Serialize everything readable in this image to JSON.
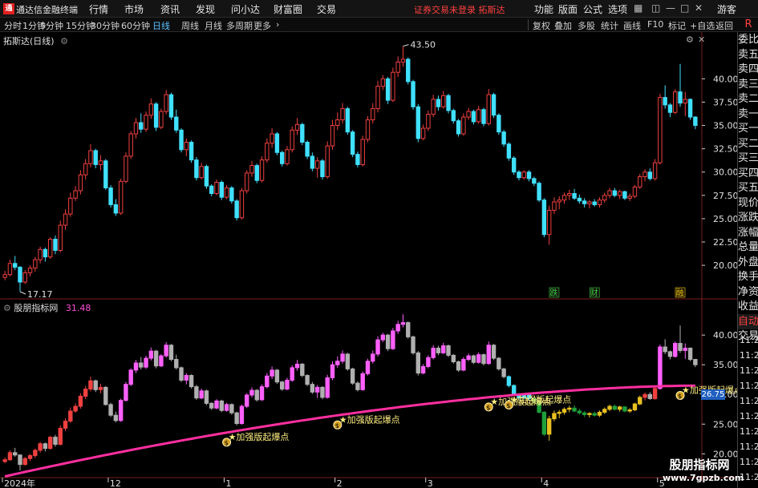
{
  "window": {
    "app_title": "通达信金融终端",
    "menu": [
      "行情",
      "市场",
      "资讯",
      "发现",
      "问小达",
      "财富圈",
      "交易"
    ],
    "warning": "证券交易未登录  拓斯达",
    "right_menu": [
      "功能",
      "版面",
      "公式",
      "选项"
    ],
    "window_controls": [
      "游客"
    ]
  },
  "toolbar": {
    "periods": [
      "分时",
      "1分钟",
      "5分钟",
      "15分钟",
      "30分钟",
      "60分钟",
      "日线",
      "周线",
      "月线",
      "多周期",
      "更多"
    ],
    "active_period": "日线",
    "tools": [
      "复权",
      "叠加",
      "多股",
      "统计",
      "画线",
      "F10",
      "标记",
      "+自选",
      "返回"
    ]
  },
  "main_panel": {
    "label": "拓斯达(日线)"
  },
  "sub_panel": {
    "label": "股朋指标网",
    "value": "31.48"
  },
  "side_panel": {
    "items": [
      "R",
      "委比",
      "卖五",
      "卖四",
      "卖三",
      "卖二",
      "卖一",
      "买一",
      "买二",
      "买三",
      "买四",
      "买五",
      "现价",
      "涨跌",
      "涨幅",
      "总量",
      "外盘",
      "换手",
      "净资",
      "收益",
      "自动",
      "交易"
    ],
    "times": [
      "11:29",
      "11:29",
      "11:29",
      "11:29",
      "11:29",
      "11:29",
      "11:29",
      "11:29",
      "11:29",
      "11:29"
    ]
  },
  "price_tag": "26.75",
  "watermark": {
    "line1": "股朋指标网",
    "line2": "www.7gpzb.com"
  },
  "chart_data": [
    {
      "type": "candlestick",
      "panel": "main",
      "y_ticks": [
        20.0,
        22.5,
        25.0,
        27.5,
        30.0,
        32.5,
        35.0,
        37.5,
        40.0
      ],
      "ylim": [
        17.0,
        44.5
      ],
      "x_ticks": [
        {
          "label": "2024年",
          "index": 0
        },
        {
          "label": "12",
          "index": 21
        },
        {
          "label": "1",
          "index": 44
        },
        {
          "label": "2",
          "index": 66
        },
        {
          "label": "3",
          "index": 84
        },
        {
          "label": "4",
          "index": 107
        },
        {
          "label": "5",
          "index": 130
        }
      ],
      "annotations": [
        {
          "text": "43.50",
          "index": 79,
          "price": 43.5
        },
        {
          "text": "17.17",
          "index": 3,
          "price": 17.17
        }
      ],
      "event_markers": [
        {
          "text": "跌",
          "index": 109,
          "color": "#3dcc3d"
        },
        {
          "text": "财",
          "index": 117,
          "color": "#3dcc3d"
        },
        {
          "text": "融",
          "index": 134,
          "color": "#ffcc00"
        }
      ],
      "ohlc": [
        [
          18.7,
          19.4,
          18.4,
          19.0
        ],
        [
          19.0,
          20.6,
          18.8,
          20.2
        ],
        [
          20.2,
          21.0,
          19.5,
          19.8
        ],
        [
          19.8,
          19.9,
          17.2,
          18.2
        ],
        [
          18.2,
          19.5,
          18.0,
          19.2
        ],
        [
          19.2,
          20.0,
          18.8,
          19.7
        ],
        [
          19.7,
          20.9,
          19.3,
          20.6
        ],
        [
          20.6,
          22.0,
          20.2,
          21.7
        ],
        [
          21.7,
          21.9,
          20.4,
          20.9
        ],
        [
          20.9,
          23.0,
          20.7,
          22.8
        ],
        [
          22.8,
          23.2,
          21.2,
          21.6
        ],
        [
          21.6,
          24.8,
          21.4,
          24.3
        ],
        [
          24.3,
          26.0,
          23.8,
          25.5
        ],
        [
          25.5,
          27.8,
          25.2,
          27.2
        ],
        [
          27.2,
          28.5,
          26.9,
          28.0
        ],
        [
          28.0,
          30.2,
          27.6,
          29.7
        ],
        [
          29.7,
          31.4,
          29.2,
          30.9
        ],
        [
          30.9,
          33.0,
          30.5,
          32.3
        ],
        [
          32.3,
          32.5,
          30.4,
          30.8
        ],
        [
          30.8,
          31.8,
          30.2,
          31.2
        ],
        [
          31.2,
          31.4,
          28.1,
          28.3
        ],
        [
          28.3,
          28.6,
          26.2,
          26.5
        ],
        [
          26.5,
          27.1,
          25.3,
          25.6
        ],
        [
          25.6,
          29.3,
          25.4,
          29.0
        ],
        [
          29.0,
          32.1,
          28.8,
          31.7
        ],
        [
          31.7,
          34.4,
          31.4,
          34.1
        ],
        [
          34.1,
          35.8,
          33.6,
          35.3
        ],
        [
          35.3,
          36.3,
          34.2,
          34.6
        ],
        [
          34.6,
          36.5,
          34.3,
          36.1
        ],
        [
          36.1,
          37.9,
          35.7,
          37.3
        ],
        [
          37.3,
          37.5,
          34.4,
          34.8
        ],
        [
          34.8,
          36.8,
          34.6,
          36.5
        ],
        [
          36.5,
          38.8,
          36.2,
          38.3
        ],
        [
          38.3,
          38.5,
          35.6,
          35.9
        ],
        [
          35.9,
          36.7,
          34.2,
          34.5
        ],
        [
          34.5,
          34.7,
          32.1,
          32.4
        ],
        [
          32.4,
          33.6,
          31.7,
          33.2
        ],
        [
          33.2,
          33.4,
          31.0,
          31.3
        ],
        [
          31.3,
          31.6,
          29.1,
          29.4
        ],
        [
          29.4,
          31.0,
          29.2,
          30.6
        ],
        [
          30.6,
          30.8,
          28.2,
          28.5
        ],
        [
          28.5,
          28.7,
          27.4,
          27.7
        ],
        [
          27.7,
          29.2,
          27.5,
          28.9
        ],
        [
          28.9,
          29.1,
          27.0,
          27.3
        ],
        [
          27.3,
          28.6,
          27.1,
          28.3
        ],
        [
          28.3,
          28.5,
          26.6,
          26.9
        ],
        [
          26.9,
          27.1,
          24.8,
          25.1
        ],
        [
          25.1,
          28.3,
          24.9,
          28.0
        ],
        [
          28.0,
          30.2,
          27.7,
          29.9
        ],
        [
          29.9,
          31.2,
          29.5,
          30.7
        ],
        [
          30.7,
          30.9,
          28.8,
          29.1
        ],
        [
          29.1,
          31.7,
          28.9,
          31.3
        ],
        [
          31.3,
          33.6,
          31.0,
          33.1
        ],
        [
          33.1,
          34.7,
          32.6,
          34.1
        ],
        [
          34.1,
          34.3,
          31.8,
          32.1
        ],
        [
          32.1,
          32.3,
          30.6,
          30.9
        ],
        [
          30.9,
          32.8,
          30.7,
          32.4
        ],
        [
          32.4,
          34.9,
          32.1,
          34.5
        ],
        [
          34.5,
          35.8,
          34.0,
          35.1
        ],
        [
          35.1,
          35.3,
          32.9,
          33.2
        ],
        [
          33.2,
          33.4,
          31.4,
          31.7
        ],
        [
          31.7,
          32.1,
          30.1,
          30.4
        ],
        [
          30.4,
          31.6,
          29.4,
          31.2
        ],
        [
          31.2,
          31.4,
          29.2,
          29.5
        ],
        [
          29.5,
          33.3,
          29.3,
          32.8
        ],
        [
          32.8,
          35.6,
          32.4,
          35.0
        ],
        [
          35.0,
          36.4,
          34.5,
          35.6
        ],
        [
          35.6,
          37.4,
          35.2,
          36.8
        ],
        [
          36.8,
          37.0,
          34.0,
          34.3
        ],
        [
          34.3,
          34.5,
          31.6,
          31.9
        ],
        [
          31.9,
          32.2,
          30.5,
          30.8
        ],
        [
          30.8,
          33.9,
          30.6,
          33.5
        ],
        [
          33.5,
          36.0,
          33.2,
          35.6
        ],
        [
          35.6,
          37.4,
          35.2,
          36.8
        ],
        [
          36.8,
          39.8,
          36.4,
          39.2
        ],
        [
          39.2,
          40.4,
          38.8,
          40.0
        ],
        [
          40.0,
          40.2,
          37.3,
          37.7
        ],
        [
          37.7,
          41.2,
          37.5,
          40.7
        ],
        [
          40.7,
          42.4,
          40.2,
          41.8
        ],
        [
          41.8,
          43.5,
          41.3,
          42.1
        ],
        [
          42.1,
          42.3,
          39.4,
          39.7
        ],
        [
          39.7,
          39.9,
          36.7,
          37.0
        ],
        [
          37.0,
          37.3,
          33.2,
          33.6
        ],
        [
          33.6,
          35.1,
          33.4,
          34.7
        ],
        [
          34.7,
          36.6,
          34.4,
          36.2
        ],
        [
          36.2,
          38.3,
          35.9,
          37.8
        ],
        [
          37.8,
          38.2,
          36.6,
          37.0
        ],
        [
          37.0,
          38.7,
          36.8,
          38.2
        ],
        [
          38.2,
          38.4,
          36.3,
          36.6
        ],
        [
          36.6,
          36.8,
          35.2,
          35.5
        ],
        [
          35.5,
          35.7,
          33.8,
          34.1
        ],
        [
          34.1,
          36.3,
          33.9,
          35.9
        ],
        [
          35.9,
          36.9,
          35.6,
          36.5
        ],
        [
          36.5,
          36.7,
          35.1,
          35.4
        ],
        [
          35.4,
          37.1,
          35.2,
          36.7
        ],
        [
          36.7,
          36.9,
          34.9,
          35.2
        ],
        [
          35.2,
          38.9,
          35.0,
          38.3
        ],
        [
          38.3,
          38.5,
          35.8,
          36.1
        ],
        [
          36.1,
          36.3,
          34.0,
          34.3
        ],
        [
          34.3,
          34.5,
          32.7,
          33.0
        ],
        [
          33.0,
          33.2,
          31.2,
          31.5
        ],
        [
          31.5,
          31.7,
          29.7,
          30.0
        ],
        [
          30.0,
          30.2,
          29.1,
          29.4
        ],
        [
          29.4,
          30.2,
          29.2,
          30.0
        ],
        [
          30.0,
          30.2,
          29.0,
          29.3
        ],
        [
          29.3,
          29.5,
          28.5,
          28.8
        ],
        [
          28.8,
          29.0,
          26.8,
          27.0
        ],
        [
          27.0,
          27.2,
          23.0,
          23.3
        ],
        [
          23.3,
          26.4,
          22.2,
          25.9
        ],
        [
          25.9,
          27.3,
          25.5,
          26.8
        ],
        [
          26.8,
          27.4,
          26.0,
          27.0
        ],
        [
          27.0,
          27.8,
          26.6,
          27.5
        ],
        [
          27.5,
          28.1,
          27.0,
          27.7
        ],
        [
          27.7,
          28.2,
          27.0,
          27.2
        ],
        [
          27.2,
          27.6,
          26.6,
          26.9
        ],
        [
          26.9,
          27.2,
          26.2,
          26.6
        ],
        [
          26.6,
          27.0,
          26.1,
          26.8
        ],
        [
          26.8,
          27.1,
          26.3,
          26.5
        ],
        [
          26.5,
          27.3,
          26.2,
          27.0
        ],
        [
          27.0,
          27.8,
          26.7,
          27.5
        ],
        [
          27.5,
          28.3,
          27.2,
          28.0
        ],
        [
          28.0,
          28.3,
          27.3,
          27.5
        ],
        [
          27.5,
          28.1,
          27.1,
          27.9
        ],
        [
          27.9,
          28.0,
          27.0,
          27.2
        ],
        [
          27.2,
          27.7,
          26.9,
          27.4
        ],
        [
          27.4,
          28.6,
          27.2,
          28.4
        ],
        [
          28.4,
          29.8,
          28.2,
          29.5
        ],
        [
          29.5,
          30.3,
          29.0,
          30.0
        ],
        [
          30.0,
          30.4,
          29.1,
          29.3
        ],
        [
          29.3,
          31.4,
          29.1,
          31.0
        ],
        [
          31.0,
          38.4,
          30.8,
          38.0
        ],
        [
          38.0,
          39.3,
          36.8,
          37.2
        ],
        [
          37.2,
          37.4,
          35.9,
          36.4
        ],
        [
          36.4,
          38.9,
          36.2,
          38.6
        ],
        [
          38.6,
          41.6,
          37.0,
          37.4
        ],
        [
          37.4,
          38.6,
          36.0,
          37.8
        ],
        [
          37.8,
          37.9,
          35.6,
          35.9
        ],
        [
          35.9,
          36.0,
          34.6,
          35.0
        ]
      ]
    },
    {
      "type": "candlestick",
      "panel": "sub",
      "name": "股朋指标网",
      "y_ticks": [
        20.0,
        25.0,
        30.0,
        35.0,
        40.0
      ],
      "ylim": [
        16.4,
        43.8
      ],
      "signal_label": "★加强版起爆点",
      "signals": [
        44,
        66,
        96,
        100,
        134
      ],
      "line_start": 16.2,
      "line_end": 31.48
    }
  ],
  "colors": {
    "up": "#f04040",
    "down": "#40e0ff",
    "ma": "#ff2fa0",
    "grid": "#7a1e1e",
    "axis": "#d0d0d0"
  }
}
